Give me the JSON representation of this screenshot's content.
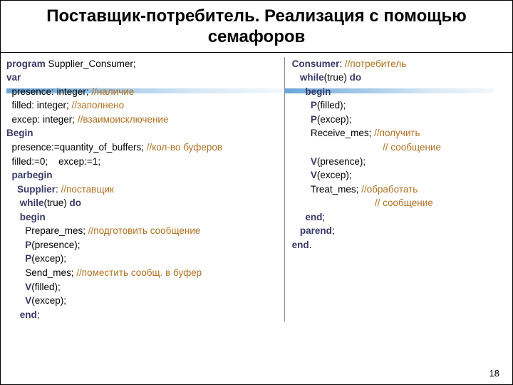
{
  "title": "Поставщик-потребитель. Реализация с помощью семафоров",
  "page_number": "18",
  "left": {
    "l1a": "program",
    "l1b": " Supplier_Consumer;",
    "l2": "var",
    "l3a": "  presence: integer; ",
    "l3b": "//наличие",
    "l4a": "  filled: integer; ",
    "l4b": "//заполнено",
    "l5a": "  excep: integer; ",
    "l5b": "//взаимоисключение",
    "l6": "Begin",
    "l7a": "  presence:=quantity_of_buffers; ",
    "l7b": "//кол-во буферов",
    "l8": "  filled:=0;    excep:=1;",
    "l9": "  parbegin",
    "l10a": "    Supplier",
    "l10b": ": ",
    "l10c": "//поставщик",
    "l11a": "     while",
    "l11b": "(true) ",
    "l11c": "do",
    "l12": "     begin",
    "l13a": "       Prepare_mes; ",
    "l13b": "//подготовить сообщение",
    "l14a": "       P",
    "l14b": "(presence);",
    "l15a": "       P",
    "l15b": "(excep);",
    "l16a": "       Send_mes; ",
    "l16b": "//поместить сообщ. в буфер",
    "l17a": "       V",
    "l17b": "(filled);",
    "l18a": "       V",
    "l18b": "(excep);",
    "l19a": "     end",
    "l19b": ";"
  },
  "right": {
    "l1a": "Consumer",
    "l1b": ": ",
    "l1c": "//потребитель",
    "l2a": "   while",
    "l2b": "(true) ",
    "l2c": "do",
    "l3": "     begin",
    "l4a": "       P",
    "l4b": "(filled);",
    "l5a": "       P",
    "l5b": "(excep);",
    "l6a": "       Receive_mes; ",
    "l6b": "//получить",
    "l7": "                                  // сообщение",
    "l8a": "       V",
    "l8b": "(presence);",
    "l9a": "       V",
    "l9b": "(excep);",
    "l10a": "       Treat_mes; ",
    "l10b": "//обработать",
    "l11": "                               // сообщение",
    "l12a": "     end",
    "l12b": ";",
    "l13a": "   parend",
    "l13b": ";",
    "l14a": "end",
    "l14b": "."
  }
}
